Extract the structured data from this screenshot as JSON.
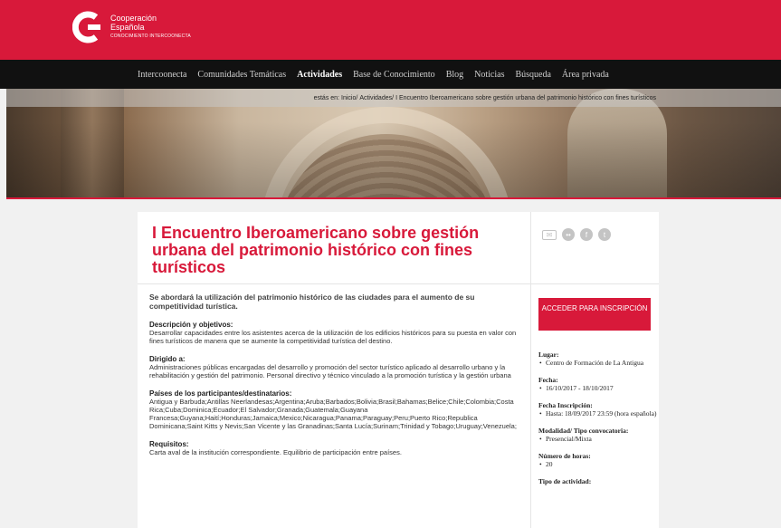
{
  "brand": {
    "line1": "Cooperación",
    "line2": "Española",
    "line3": "CONOCIMIENTO INTERCOONECTA",
    "color": "#d8193a"
  },
  "nav": {
    "items": [
      {
        "label": "Intercoonecta",
        "active": false
      },
      {
        "label": "Comunidades Temáticas",
        "active": false
      },
      {
        "label": "Actividades",
        "active": true
      },
      {
        "label": "Base de Conocimiento",
        "active": false
      },
      {
        "label": "Blog",
        "active": false
      },
      {
        "label": "Noticias",
        "active": false
      },
      {
        "label": "Búsqueda",
        "active": false
      },
      {
        "label": "Área privada",
        "active": false
      }
    ]
  },
  "breadcrumb": {
    "prefix": "estás en:",
    "home": "Inicio/",
    "section": "Actividades/",
    "current": "I Encuentro Iberoamericano sobre gestión urbana del patrimonio histórico con fines turísticos"
  },
  "article": {
    "title": "I Encuentro Iberoamericano sobre gestión urbana del patrimonio histórico con fines turísticos",
    "lead": "Se abordará la utilización del patrimonio histórico de las ciudades para el aumento de su competitividad turística.",
    "sections": [
      {
        "heading": "Descripción y objetivos:",
        "text": "Desarrollar capacidades entre los asistentes acerca de la utilización de los edificios históricos para su puesta en valor con fines turísticos de manera que se aumente la competitividad turística del destino."
      },
      {
        "heading": "Dirigido a:",
        "text": "Administraciones públicas encargadas del desarrollo y promoción del sector turístico aplicado al desarrollo urbano y la rehabilitación y gestión del patrimonio. Personal directivo y técnico vinculado a la promoción turística y la gestión urbana"
      },
      {
        "heading": "Países de los participantes/destinatarios:",
        "text": "Antigua y Barbuda;Antillas Neerlandesas;Argentina;Aruba;Barbados;Bolivia;Brasil;Bahamas;Belice;Chile;Colombia;Costa Rica;Cuba;Dominica;Ecuador;El Salvador;Granada;Guatemala;Guayana Francesa;Guyana;Haití;Honduras;Jamaica;Mexico;Nicaragua;Panama;Paraguay;Peru;Puerto Rico;Republica Dominicana;Saint Kitts y Nevis;San Vicente y las Granadinas;Santa Lucía;Surinam;Trinidad y Tobago;Uruguay;Venezuela;"
      },
      {
        "heading": "Requisitos:",
        "text": "Carta aval de la institución correspondiente. Equilibrio de participación entre países."
      }
    ]
  },
  "share": {
    "icons": [
      "mail-icon",
      "flickr-icon",
      "facebook-icon",
      "twitter-icon"
    ]
  },
  "sidebar": {
    "cta_label": "ACCEDER PARA INSCRIPCIÓN",
    "info": [
      {
        "label": "Lugar:",
        "value": "Centro de Formación de La Antigua"
      },
      {
        "label": "Fecha:",
        "value": "16/10/2017 - 18/10/2017"
      },
      {
        "label": "Fecha Inscripción:",
        "value": "Hasta: 18/09/2017 23:59 (hora española)"
      },
      {
        "label": "Modalidad/ Tipo convocatoria:",
        "value": "Presencial/Mixta"
      },
      {
        "label": "Número de horas:",
        "value": "20"
      },
      {
        "label": "Tipo de actividad:",
        "value": ""
      }
    ]
  }
}
